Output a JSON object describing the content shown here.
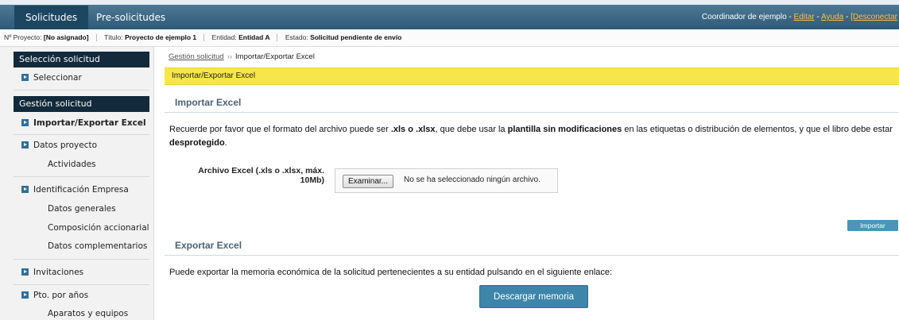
{
  "topbar": {
    "tabs": [
      {
        "label": "Solicitudes",
        "active": true
      },
      {
        "label": "Pre-solicitudes",
        "active": false
      }
    ],
    "user": "Coordinador de ejemplo",
    "edit_link": "Editar",
    "help_link": "Ayuda",
    "logout_link": "[Desconectar",
    "separator": " - "
  },
  "infobar": {
    "project_no_label": "Nº Proyecto:",
    "project_no_value": "[No asignado]",
    "title_label": "Título:",
    "title_value": "Proyecto de ejemplo 1",
    "entity_label": "Entidad:",
    "entity_value": "Entidad A",
    "state_label": "Estado:",
    "state_value": "Solicitud pendiente de envío"
  },
  "sidebar": {
    "section1_title": "Selección solicitud",
    "select_item": "Seleccionar",
    "section2_title": "Gestión solicitud",
    "items": {
      "import_export": "Importar/Exportar Excel",
      "datos_proyecto": "Datos proyecto",
      "actividades": "Actividades",
      "identificacion": "Identificación Empresa",
      "datos_generales": "Datos generales",
      "composicion": "Composición accionarial",
      "datos_complementarios": "Datos complementarios",
      "invitaciones": "Invitaciones",
      "pto_anos": "Pto. por años",
      "aparatos": "Aparatos y equipos"
    }
  },
  "breadcrumb": {
    "parent": "Gestión solicitud",
    "separator": "››",
    "current": "Importar/Exportar Excel"
  },
  "page_banner": "Importar/Exportar Excel",
  "import": {
    "title": "Importar Excel",
    "text_1": "Recuerde por favor que el formato del archivo puede ser ",
    "text_format": ".xls o .xlsx",
    "text_2": ", que debe usar la ",
    "text_template": "plantilla sin modificaciones",
    "text_3": " en las etiquetas o distribución de elementos, y que el libro debe estar ",
    "text_unprotected": "desprotegido",
    "text_4": ".",
    "file_label": "Archivo Excel (.xls o .xlsx, máx. 10Mb)",
    "browse_button": "Examinar...",
    "file_status": "No se ha seleccionado ningún archivo.",
    "submit_button": "Importar"
  },
  "export": {
    "title": "Exportar Excel",
    "text": "Puede exportar la memoria económica de la solicitud pertenecientes a su entidad pulsando en el siguiente enlace:",
    "download_button": "Descargar memoria"
  }
}
